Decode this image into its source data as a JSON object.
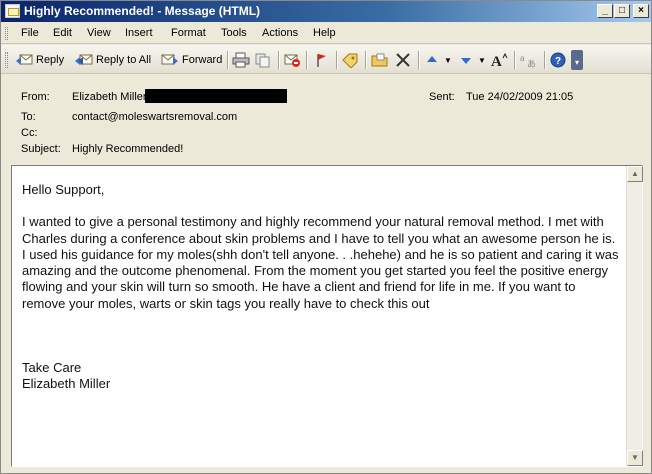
{
  "window": {
    "title": "Highly Recommended! - Message (HTML)",
    "min_glyph": "_",
    "max_glyph": "□",
    "close_glyph": "×"
  },
  "menubar": {
    "items": [
      "File",
      "Edit",
      "View",
      "Insert",
      "Format",
      "Tools",
      "Actions",
      "Help"
    ]
  },
  "toolbar": {
    "reply_label": "Reply",
    "reply_all_label": "Reply to All",
    "forward_label": "Forward",
    "icons": [
      "print-icon",
      "copy-icon",
      "junk-icon",
      "flag-icon",
      "categorize-icon",
      "move-icon",
      "delete-icon",
      "previous-icon",
      "next-icon",
      "font-size-icon",
      "translate-icon",
      "help-icon"
    ]
  },
  "header": {
    "from_label": "From:",
    "from_value": "Elizabeth Miller",
    "sent_label": "Sent:",
    "sent_value": "Tue 24/02/2009 21:05",
    "to_label": "To:",
    "to_value": "contact@moleswartsremoval.com",
    "cc_label": "Cc:",
    "cc_value": "",
    "subject_label": "Subject:",
    "subject_value": "Highly Recommended!"
  },
  "body": {
    "greeting": "Hello Support,",
    "paragraph": "I wanted to give a personal testimony and highly recommend your natural removal method. I met with Charles during a conference about skin problems and I have to tell you what an awesome person he is. I used his guidance for my moles(shh don't tell anyone. . .hehehe) and he is so patient and caring it was amazing and the outcome phenomenal. From the moment you get started you feel the positive energy flowing and your skin will turn so smooth. He have a client and friend for life in me. If you want to remove your moles, warts or skin tags you really have to check this out",
    "closing": "Take Care",
    "signature": "Elizabeth Miller"
  },
  "colors": {
    "titlebar_start": "#0a246a",
    "titlebar_end": "#a6caf0",
    "chrome": "#ece9d8"
  }
}
